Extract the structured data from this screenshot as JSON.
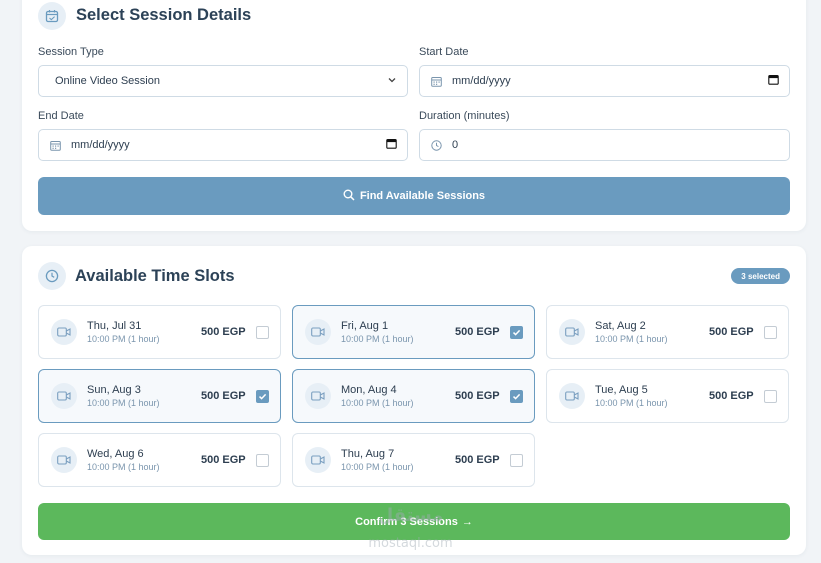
{
  "session_details": {
    "title": "Select Session Details",
    "header_icon": "calendar-icon",
    "session_type": {
      "label": "Session Type",
      "value": "Online Video Session"
    },
    "start_date": {
      "label": "Start Date",
      "placeholder": "mm/dd/yyyy"
    },
    "end_date": {
      "label": "End Date",
      "placeholder": "mm/dd/yyyy"
    },
    "duration": {
      "label": "Duration (minutes)",
      "value": "0"
    },
    "find_button": "Find Available Sessions"
  },
  "time_slots": {
    "title": "Available Time Slots",
    "header_icon": "clock-icon",
    "badge": "3 selected",
    "slots": [
      {
        "date": "Thu, Jul 31",
        "time": "10:00 PM (1 hour)",
        "price": "500 EGP",
        "selected": false
      },
      {
        "date": "Fri, Aug 1",
        "time": "10:00 PM (1 hour)",
        "price": "500 EGP",
        "selected": true
      },
      {
        "date": "Sat, Aug 2",
        "time": "10:00 PM (1 hour)",
        "price": "500 EGP",
        "selected": false
      },
      {
        "date": "Sun, Aug 3",
        "time": "10:00 PM (1 hour)",
        "price": "500 EGP",
        "selected": true
      },
      {
        "date": "Mon, Aug 4",
        "time": "10:00 PM (1 hour)",
        "price": "500 EGP",
        "selected": true
      },
      {
        "date": "Tue, Aug 5",
        "time": "10:00 PM (1 hour)",
        "price": "500 EGP",
        "selected": false
      },
      {
        "date": "Wed, Aug 6",
        "time": "10:00 PM (1 hour)",
        "price": "500 EGP",
        "selected": false
      },
      {
        "date": "Thu, Aug 7",
        "time": "10:00 PM (1 hour)",
        "price": "500 EGP",
        "selected": false
      }
    ],
    "confirm_button": "Confirm 3 Sessions",
    "confirm_arrow": "→"
  },
  "colors": {
    "accent": "#6a9bbf",
    "success": "#5cb85c",
    "title": "#2c4257"
  },
  "watermark": {
    "arabic": "مستقل",
    "domain": "mostaql.com"
  }
}
